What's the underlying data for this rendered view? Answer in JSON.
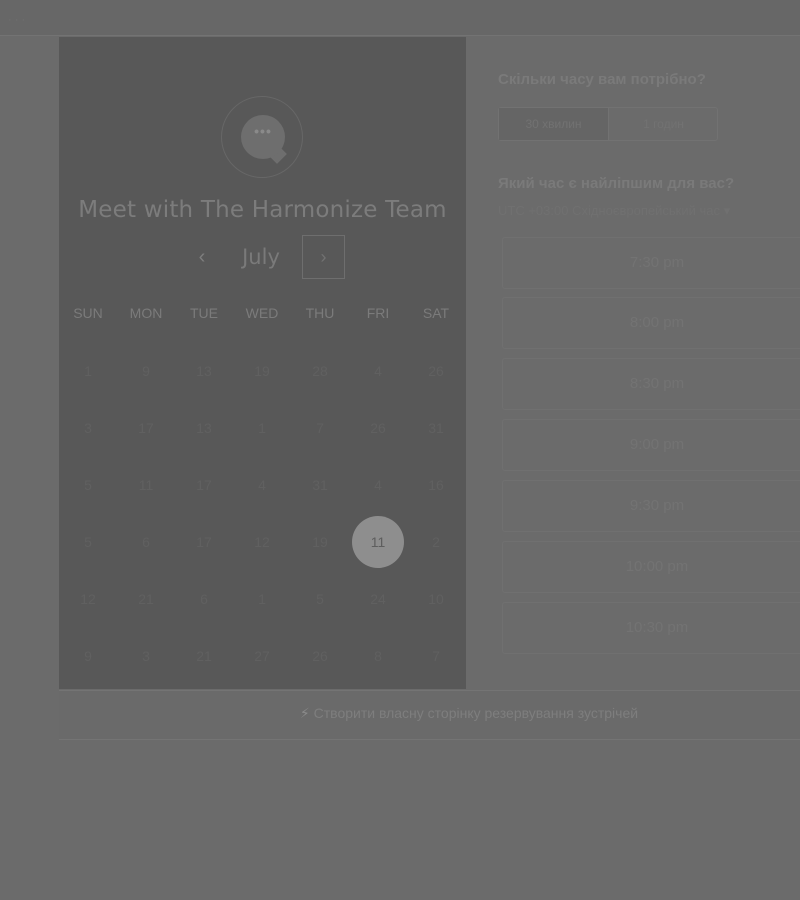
{
  "top_bar": {
    "text": "· · ·"
  },
  "header": {
    "avatar_dots": "•••",
    "title": "Meet with The Harmonize Team"
  },
  "calendar": {
    "prev_icon": "‹",
    "month": "July",
    "next_icon": "›",
    "weekdays": [
      "SUN",
      "MON",
      "TUE",
      "WED",
      "THU",
      "FRI",
      "SAT"
    ],
    "rows": [
      [
        "1",
        "9",
        "13",
        "19",
        "28",
        "4",
        "26"
      ],
      [
        "3",
        "17",
        "13",
        "1",
        "7",
        "26",
        "31"
      ],
      [
        "5",
        "11",
        "17",
        "4",
        "31",
        "4",
        "16"
      ],
      [
        "5",
        "6",
        "17",
        "12",
        "19",
        "11",
        "2"
      ],
      [
        "12",
        "21",
        "6",
        "1",
        "5",
        "24",
        "10"
      ],
      [
        "9",
        "3",
        "21",
        "27",
        "26",
        "8",
        "7"
      ]
    ],
    "selected_day": "11"
  },
  "duration": {
    "question": "Скільки часу вам потрібно?",
    "options": [
      "30 хвилин",
      "1 годин"
    ]
  },
  "time": {
    "question": "Який час є найліпшим для вас?",
    "timezone": "UTC +03:00 Східноєвропейський час ▾",
    "slots": [
      "7:30 pm",
      "8:00 pm",
      "8:30 pm",
      "9:00 pm",
      "9:30 pm",
      "10:00 pm",
      "10:30 pm"
    ]
  },
  "footer": {
    "icon": "⚡",
    "link_text": "Створити власну сторінку резервування зустрічей"
  }
}
